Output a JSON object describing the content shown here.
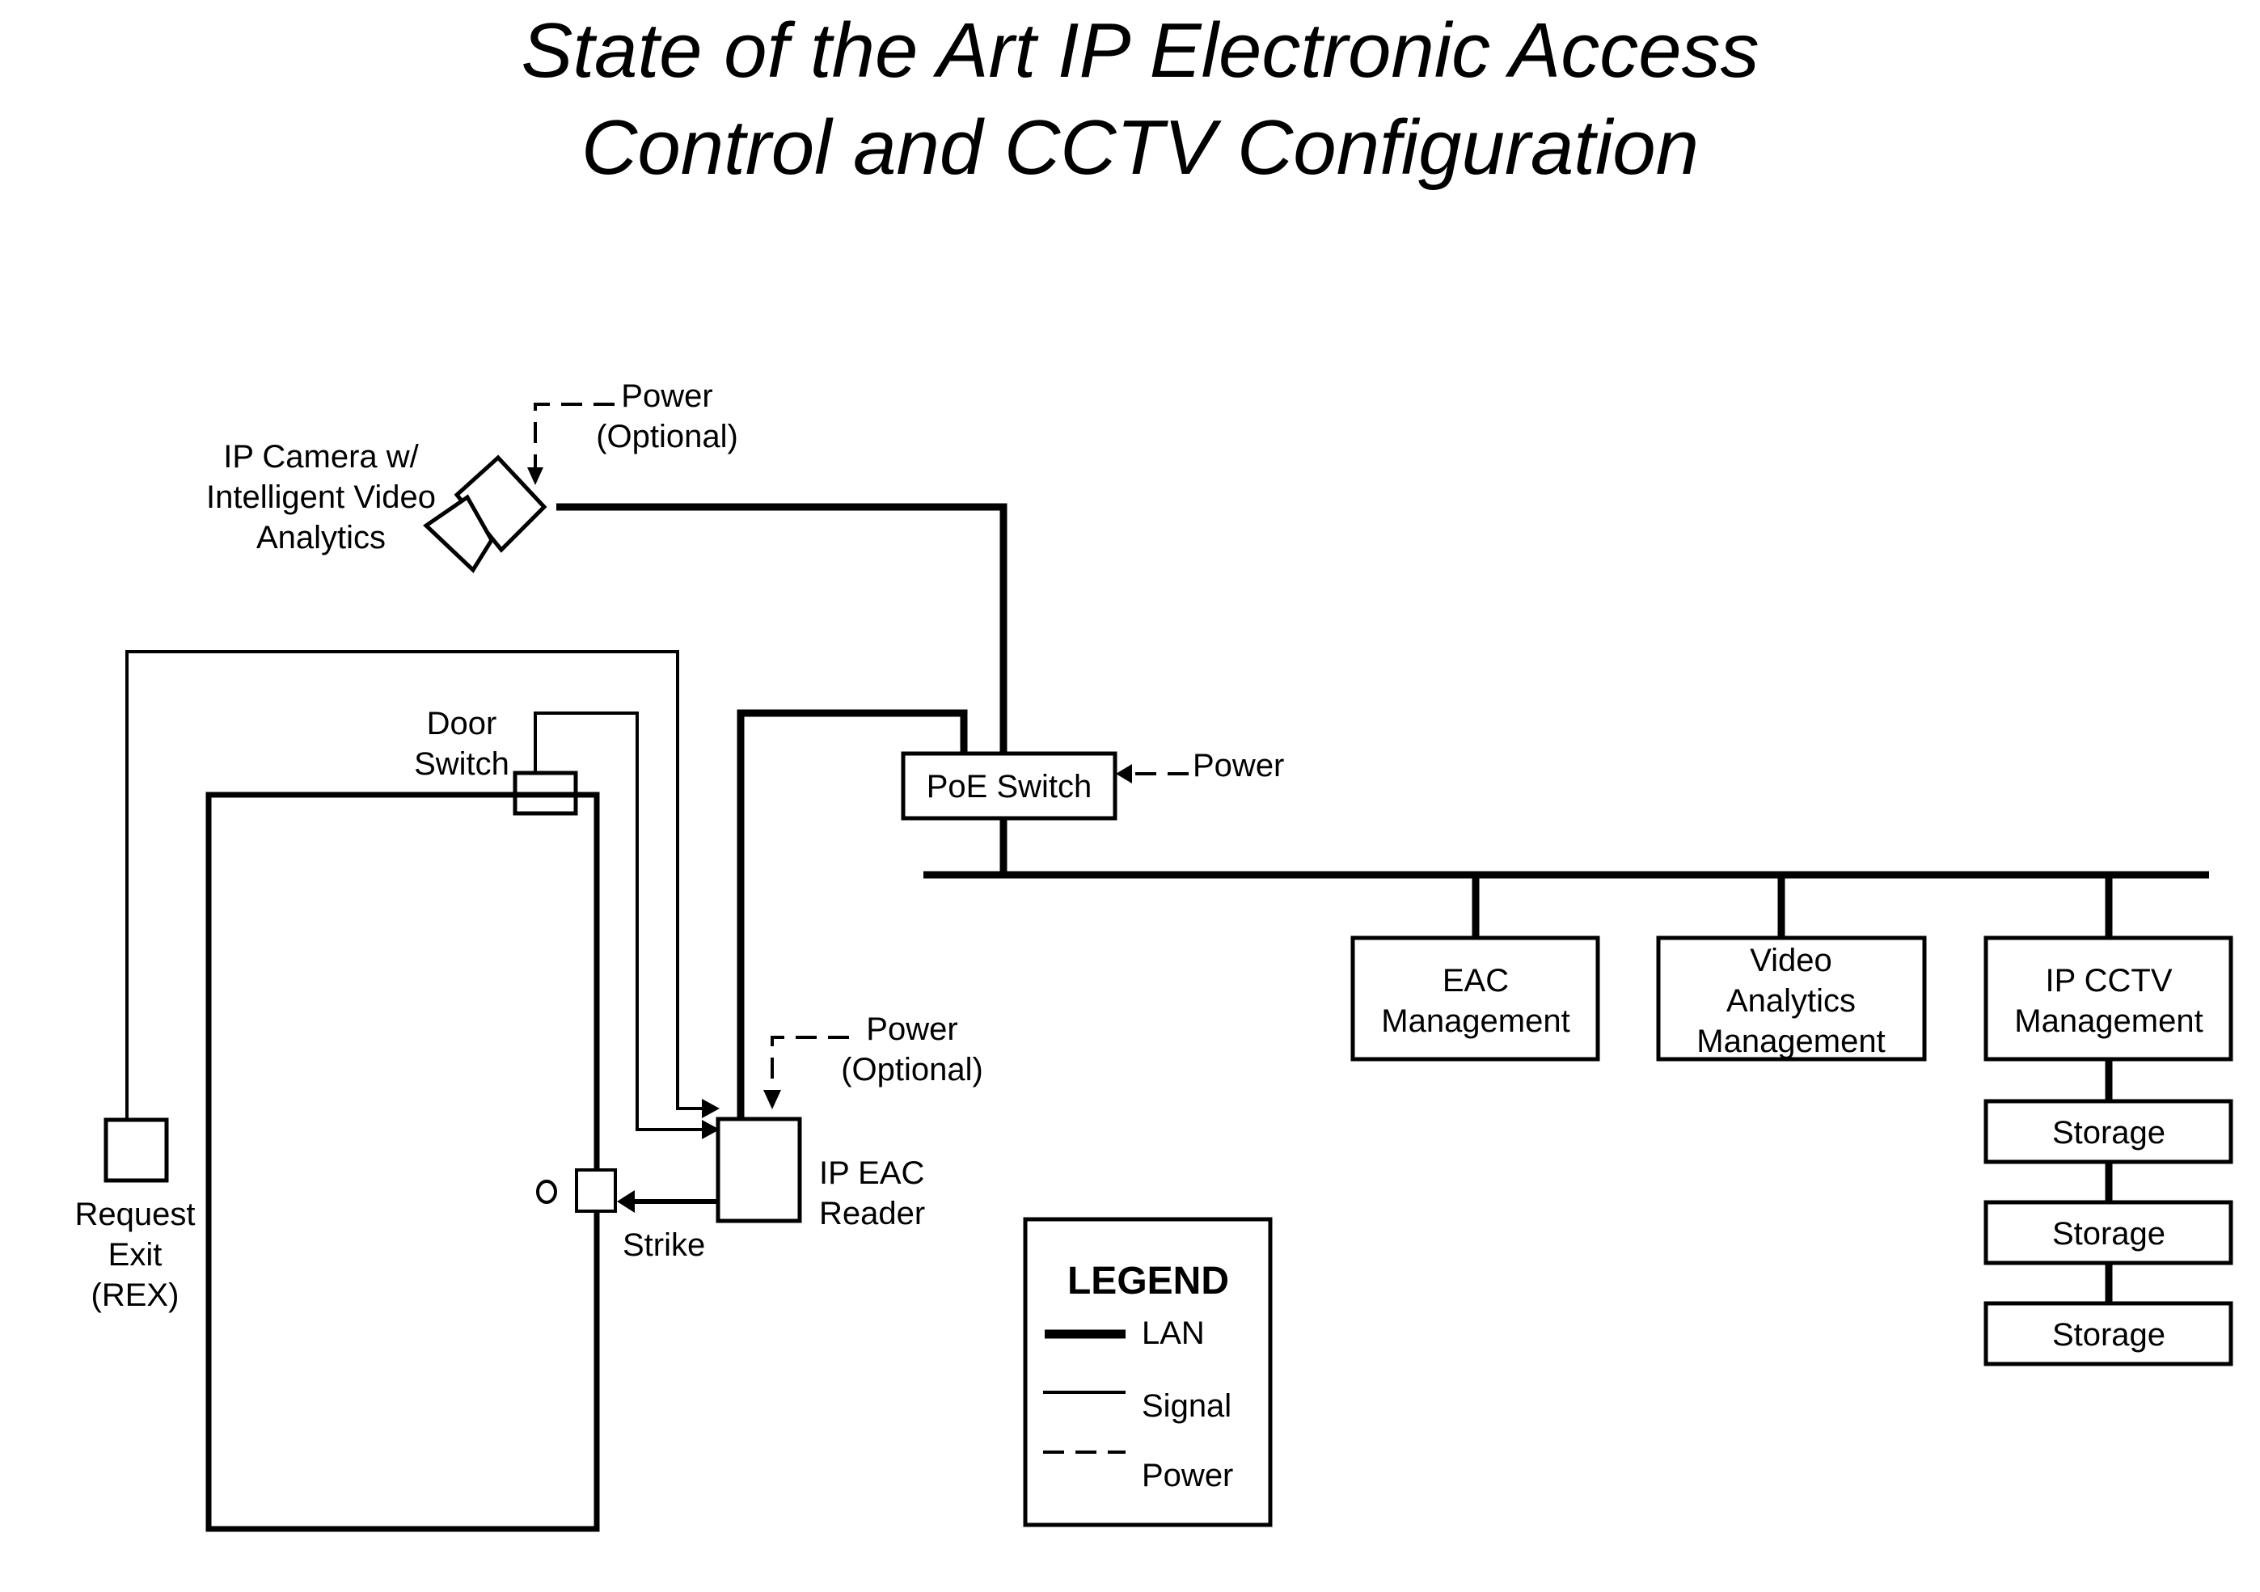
{
  "title": {
    "line1": "State of the Art IP Electronic Access",
    "line2": "Control and CCTV Configuration"
  },
  "camera": {
    "label_lines": [
      "IP Camera w/",
      "Intelligent Video",
      "Analytics"
    ],
    "power_lines": [
      "Power",
      "(Optional)"
    ]
  },
  "door_switch": {
    "label_lines": [
      "Door",
      "Switch"
    ]
  },
  "poe_switch": {
    "label": "PoE Switch",
    "power": "Power"
  },
  "rex": {
    "label_lines": [
      "Request",
      "Exit",
      "(REX)"
    ]
  },
  "strike": {
    "label": "Strike"
  },
  "reader": {
    "label_lines": [
      "IP EAC",
      "Reader"
    ],
    "power_lines": [
      "Power",
      "(Optional)"
    ]
  },
  "servers": [
    {
      "id": "eac",
      "lines": [
        "EAC",
        "Management"
      ]
    },
    {
      "id": "video-analytics",
      "lines": [
        "Video",
        "Analytics",
        "Management"
      ]
    },
    {
      "id": "ip-cctv",
      "lines": [
        "IP CCTV",
        "Management"
      ]
    }
  ],
  "storage": [
    "Storage",
    "Storage",
    "Storage"
  ],
  "legend": {
    "title": "LEGEND",
    "items": [
      {
        "type": "lan",
        "label": "LAN"
      },
      {
        "type": "signal",
        "label": "Signal"
      },
      {
        "type": "power",
        "label": "Power"
      }
    ]
  },
  "colors": {
    "line": "#000000",
    "background": "#ffffff"
  }
}
